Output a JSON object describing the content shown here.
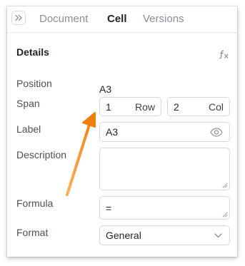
{
  "tabs": [
    {
      "label": "Document",
      "active": false
    },
    {
      "label": "Cell",
      "active": true
    },
    {
      "label": "Versions",
      "active": false
    }
  ],
  "details": {
    "title": "Details",
    "position_label": "Position",
    "position_value": "A3",
    "span_label": "Span",
    "span_rows_value": "1",
    "span_rows_unit": "Row",
    "span_cols_value": "2",
    "span_cols_unit": "Col",
    "label_label": "Label",
    "label_value": "A3",
    "description_label": "Description",
    "description_value": "",
    "formula_label": "Formula",
    "formula_value": "=",
    "format_label": "Format",
    "format_value": "General"
  },
  "icons": {
    "expand": "double-chevron-right-icon",
    "formula": "function-fx-icon",
    "visibility": "eye-icon",
    "dropdown": "chevron-down-icon"
  },
  "colors": {
    "annotation_arrow": "#f5891e",
    "active_tab": "#1f2328",
    "inactive_tab": "#8a8f98"
  }
}
